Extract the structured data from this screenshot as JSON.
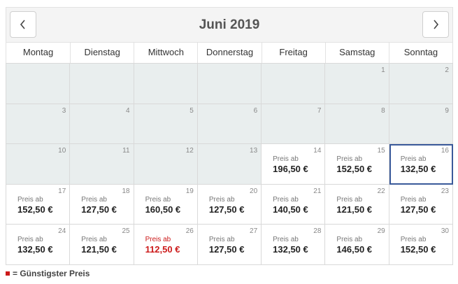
{
  "month_title": "Juni 2019",
  "nav": {
    "prev_icon": "chevron-left-icon",
    "next_icon": "chevron-right-icon"
  },
  "weekdays": [
    "Montag",
    "Dienstag",
    "Mittwoch",
    "Donnerstag",
    "Freitag",
    "Samstag",
    "Sonntag"
  ],
  "price_prefix": "Preis ab",
  "colors": {
    "cheapest": "#cc1a1a",
    "selected_border": "#3a5a9a",
    "disabled_bg": "#e9eeee"
  },
  "days": [
    {
      "day": "",
      "disabled": true
    },
    {
      "day": "",
      "disabled": true
    },
    {
      "day": "",
      "disabled": true
    },
    {
      "day": "",
      "disabled": true
    },
    {
      "day": "",
      "disabled": true
    },
    {
      "day": "1",
      "disabled": true
    },
    {
      "day": "2",
      "disabled": true
    },
    {
      "day": "3",
      "disabled": true
    },
    {
      "day": "4",
      "disabled": true
    },
    {
      "day": "5",
      "disabled": true
    },
    {
      "day": "6",
      "disabled": true
    },
    {
      "day": "7",
      "disabled": true
    },
    {
      "day": "8",
      "disabled": true
    },
    {
      "day": "9",
      "disabled": true
    },
    {
      "day": "10",
      "disabled": true
    },
    {
      "day": "11",
      "disabled": true
    },
    {
      "day": "12",
      "disabled": true
    },
    {
      "day": "13",
      "disabled": true
    },
    {
      "day": "14",
      "price": "196,50 €"
    },
    {
      "day": "15",
      "price": "152,50 €"
    },
    {
      "day": "16",
      "price": "132,50 €",
      "selected": true
    },
    {
      "day": "17",
      "price": "152,50 €"
    },
    {
      "day": "18",
      "price": "127,50 €"
    },
    {
      "day": "19",
      "price": "160,50 €"
    },
    {
      "day": "20",
      "price": "127,50 €"
    },
    {
      "day": "21",
      "price": "140,50 €"
    },
    {
      "day": "22",
      "price": "121,50 €"
    },
    {
      "day": "23",
      "price": "127,50 €"
    },
    {
      "day": "24",
      "price": "132,50 €"
    },
    {
      "day": "25",
      "price": "121,50 €"
    },
    {
      "day": "26",
      "price": "112,50 €",
      "cheapest": true
    },
    {
      "day": "27",
      "price": "127,50 €"
    },
    {
      "day": "28",
      "price": "132,50 €"
    },
    {
      "day": "29",
      "price": "146,50 €"
    },
    {
      "day": "30",
      "price": "152,50 €"
    }
  ],
  "legend": {
    "label": "= Günstigster Preis"
  }
}
